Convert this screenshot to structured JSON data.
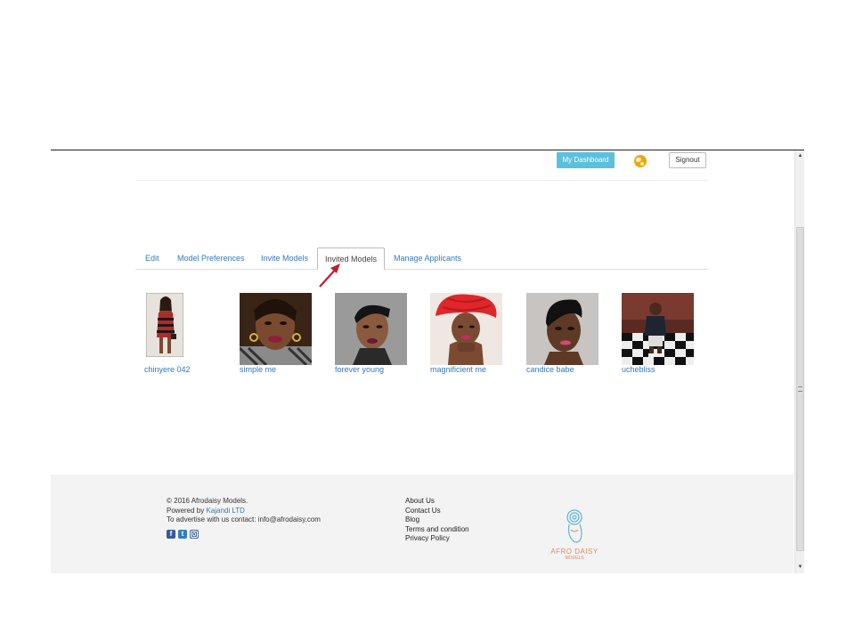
{
  "header": {
    "dashboard_label": "My Dashboard",
    "signout_label": "Signout",
    "globe_icon": "globe-icon"
  },
  "tabs": [
    {
      "label": "Edit",
      "active": false
    },
    {
      "label": "Model Preferences",
      "active": false
    },
    {
      "label": "Invite Models",
      "active": false
    },
    {
      "label": "Invited Models",
      "active": true
    },
    {
      "label": "Manage Applicants",
      "active": false
    }
  ],
  "models": [
    {
      "name": "chinyere 042"
    },
    {
      "name": "simple me"
    },
    {
      "name": "forever young"
    },
    {
      "name": "magnificient me"
    },
    {
      "name": "candice babe"
    },
    {
      "name": "uchebliss"
    }
  ],
  "footer": {
    "copyright": "© 2016 Afrodaisy Models.",
    "powered_prefix": "Powered by ",
    "powered_link": "Kajandi LTD",
    "advertise": "To advertise with us contact: info@afrodaisy.com",
    "social_icons": [
      "facebook-icon",
      "twitter-icon",
      "instagram-icon"
    ],
    "links": [
      "About Us",
      "Contact Us",
      "Blog",
      "Terms and condition",
      "Privacy Policy"
    ],
    "brand": "AFRO DAISY",
    "brand_sub": "MODELS"
  },
  "colors": {
    "accent": "#5bc0de",
    "link": "#337ab7",
    "arrow": "#c0202a",
    "footer_bg": "#f3f3f3"
  }
}
